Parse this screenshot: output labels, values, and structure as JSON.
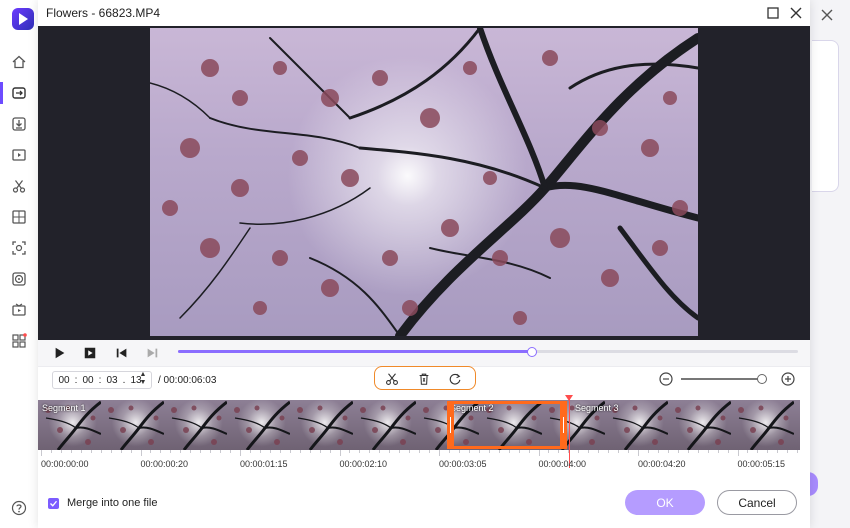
{
  "window": {
    "title": "Flowers - 66823.MP4"
  },
  "playback": {
    "progress": 0.57
  },
  "time": {
    "hh": "00",
    "mm": "00",
    "ss": "03",
    "ff": "13",
    "total": "/ 00:00:06:03"
  },
  "zoom": {
    "level": 0.95
  },
  "segments": [
    {
      "label": "Segment 1"
    },
    {
      "label": "Segment 2"
    },
    {
      "label": "Segment 3"
    }
  ],
  "ruler": [
    "00:00:00:00",
    "00:00:00:20",
    "00:00:01:15",
    "00:00:02:10",
    "00:00:03:05",
    "00:00:04:00",
    "00:00:04:20",
    "00:00:05:15"
  ],
  "merge": {
    "label": "Merge into one file",
    "checked": true
  },
  "buttons": {
    "ok": "OK",
    "cancel": "Cancel"
  },
  "colors": {
    "accent": "#7c5cff",
    "selection": "#ff6a1c",
    "playhead": "#ff4d4d"
  },
  "icons": [
    "home-icon",
    "convert-icon",
    "download-icon",
    "video-icon",
    "scissors-icon",
    "compress-icon",
    "screen-record-icon",
    "dvd-icon",
    "tv-icon",
    "apps-icon",
    "help-icon"
  ]
}
